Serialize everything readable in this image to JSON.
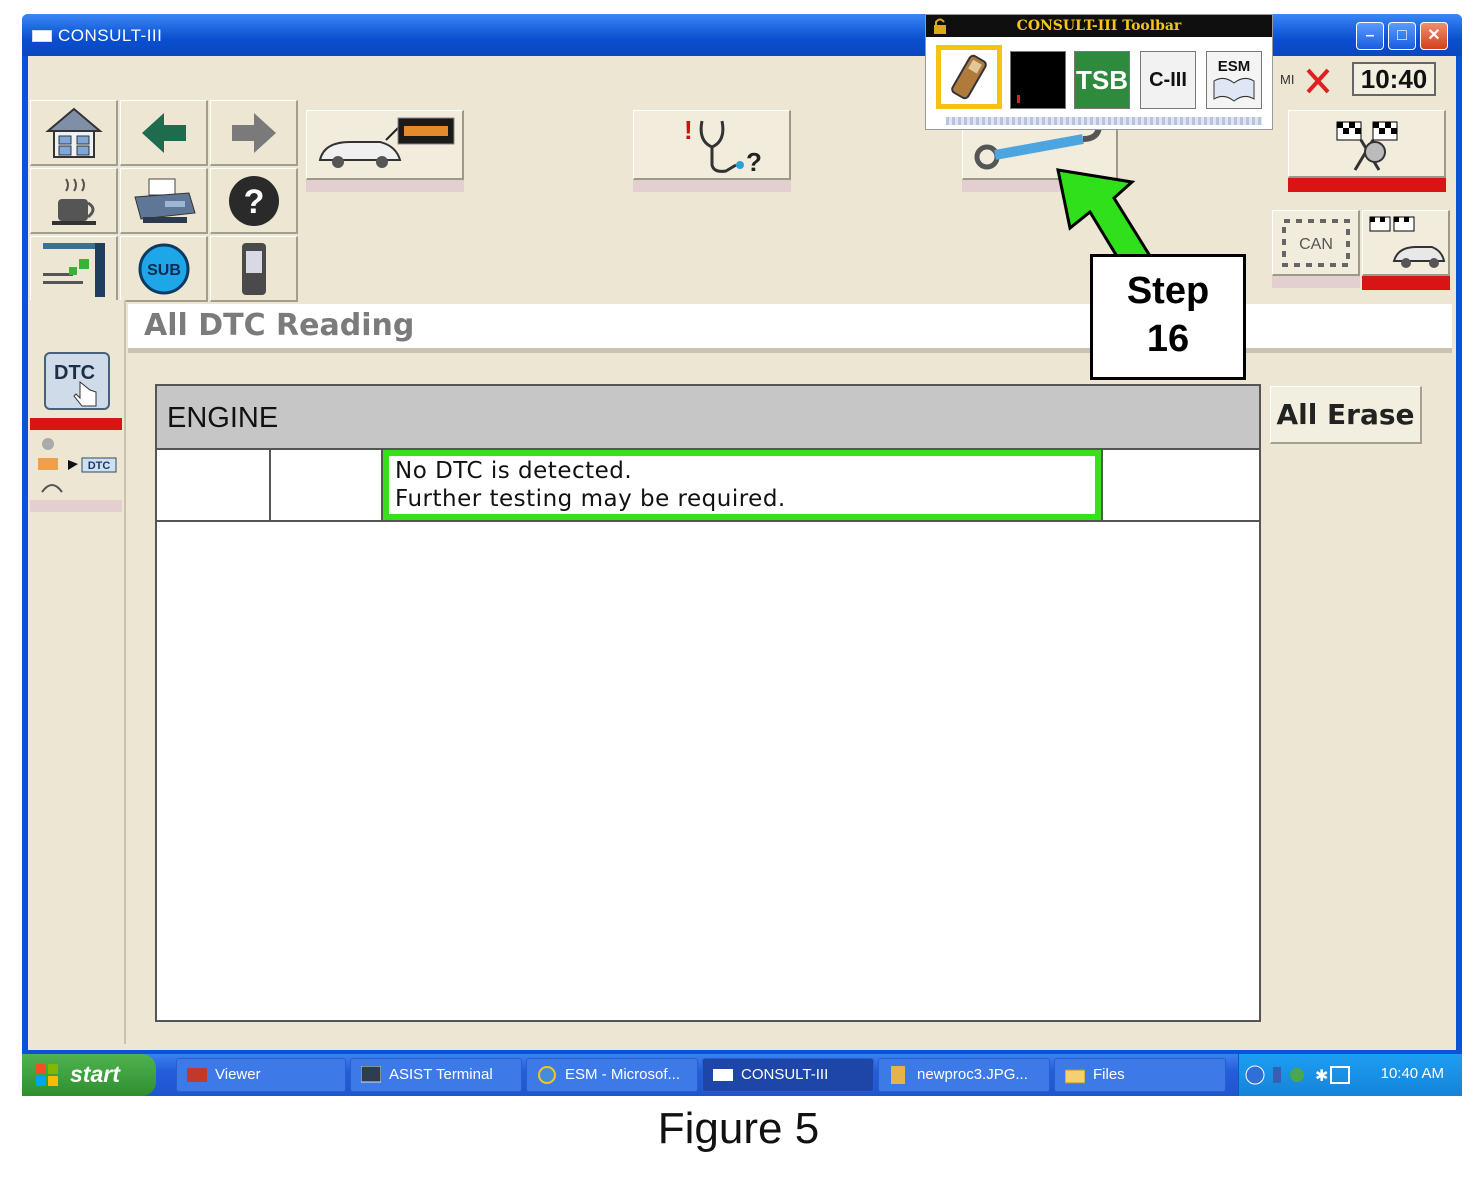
{
  "window": {
    "title": "CONSULT-III",
    "controls": {
      "minimize": "–",
      "maximize": "□",
      "close": "✕"
    }
  },
  "consult_toolbar": {
    "title": "CONSULT-III Toolbar",
    "items": [
      "battery-icon",
      "signal-meter-icon",
      "TSB",
      "C-III",
      "ESM"
    ]
  },
  "status": {
    "mi_label": "MI",
    "clock": "10:40"
  },
  "nav_grid": {
    "items": [
      "home-icon",
      "back-arrow-icon",
      "forward-arrow-icon",
      "coffee-icon",
      "printer-icon",
      "help-icon",
      "ecu-connection-icon",
      "SUB",
      "vi-device-icon"
    ]
  },
  "main_buttons": [
    "vehicle-screen-icon",
    "diagnosis-stethoscope-icon",
    "wrench-icon",
    "checkered-flags-icon",
    "can-diagnosis-icon",
    "race-car-icon"
  ],
  "can_label": "CAN",
  "side_panel": {
    "dtc_label": "DTC",
    "dtc_small_label": "DTC"
  },
  "page": {
    "heading": "All DTC Reading",
    "erase_button": "All Erase"
  },
  "dtc_table": {
    "system": "ENGINE",
    "message_line1": "No DTC is detected.",
    "message_line2": "Further testing may be required."
  },
  "annotation": {
    "step_word": "Step",
    "step_number": "16",
    "arrow_color": "#2fe01a"
  },
  "taskbar": {
    "start_label": "start",
    "tasks": [
      "Viewer",
      "ASIST Terminal",
      "ESM - Microsof...",
      "CONSULT-III",
      "newproc3.JPG...",
      "Files"
    ],
    "active_task": "CONSULT-III",
    "tray_time": "10:40 AM"
  },
  "caption": "Figure 5"
}
